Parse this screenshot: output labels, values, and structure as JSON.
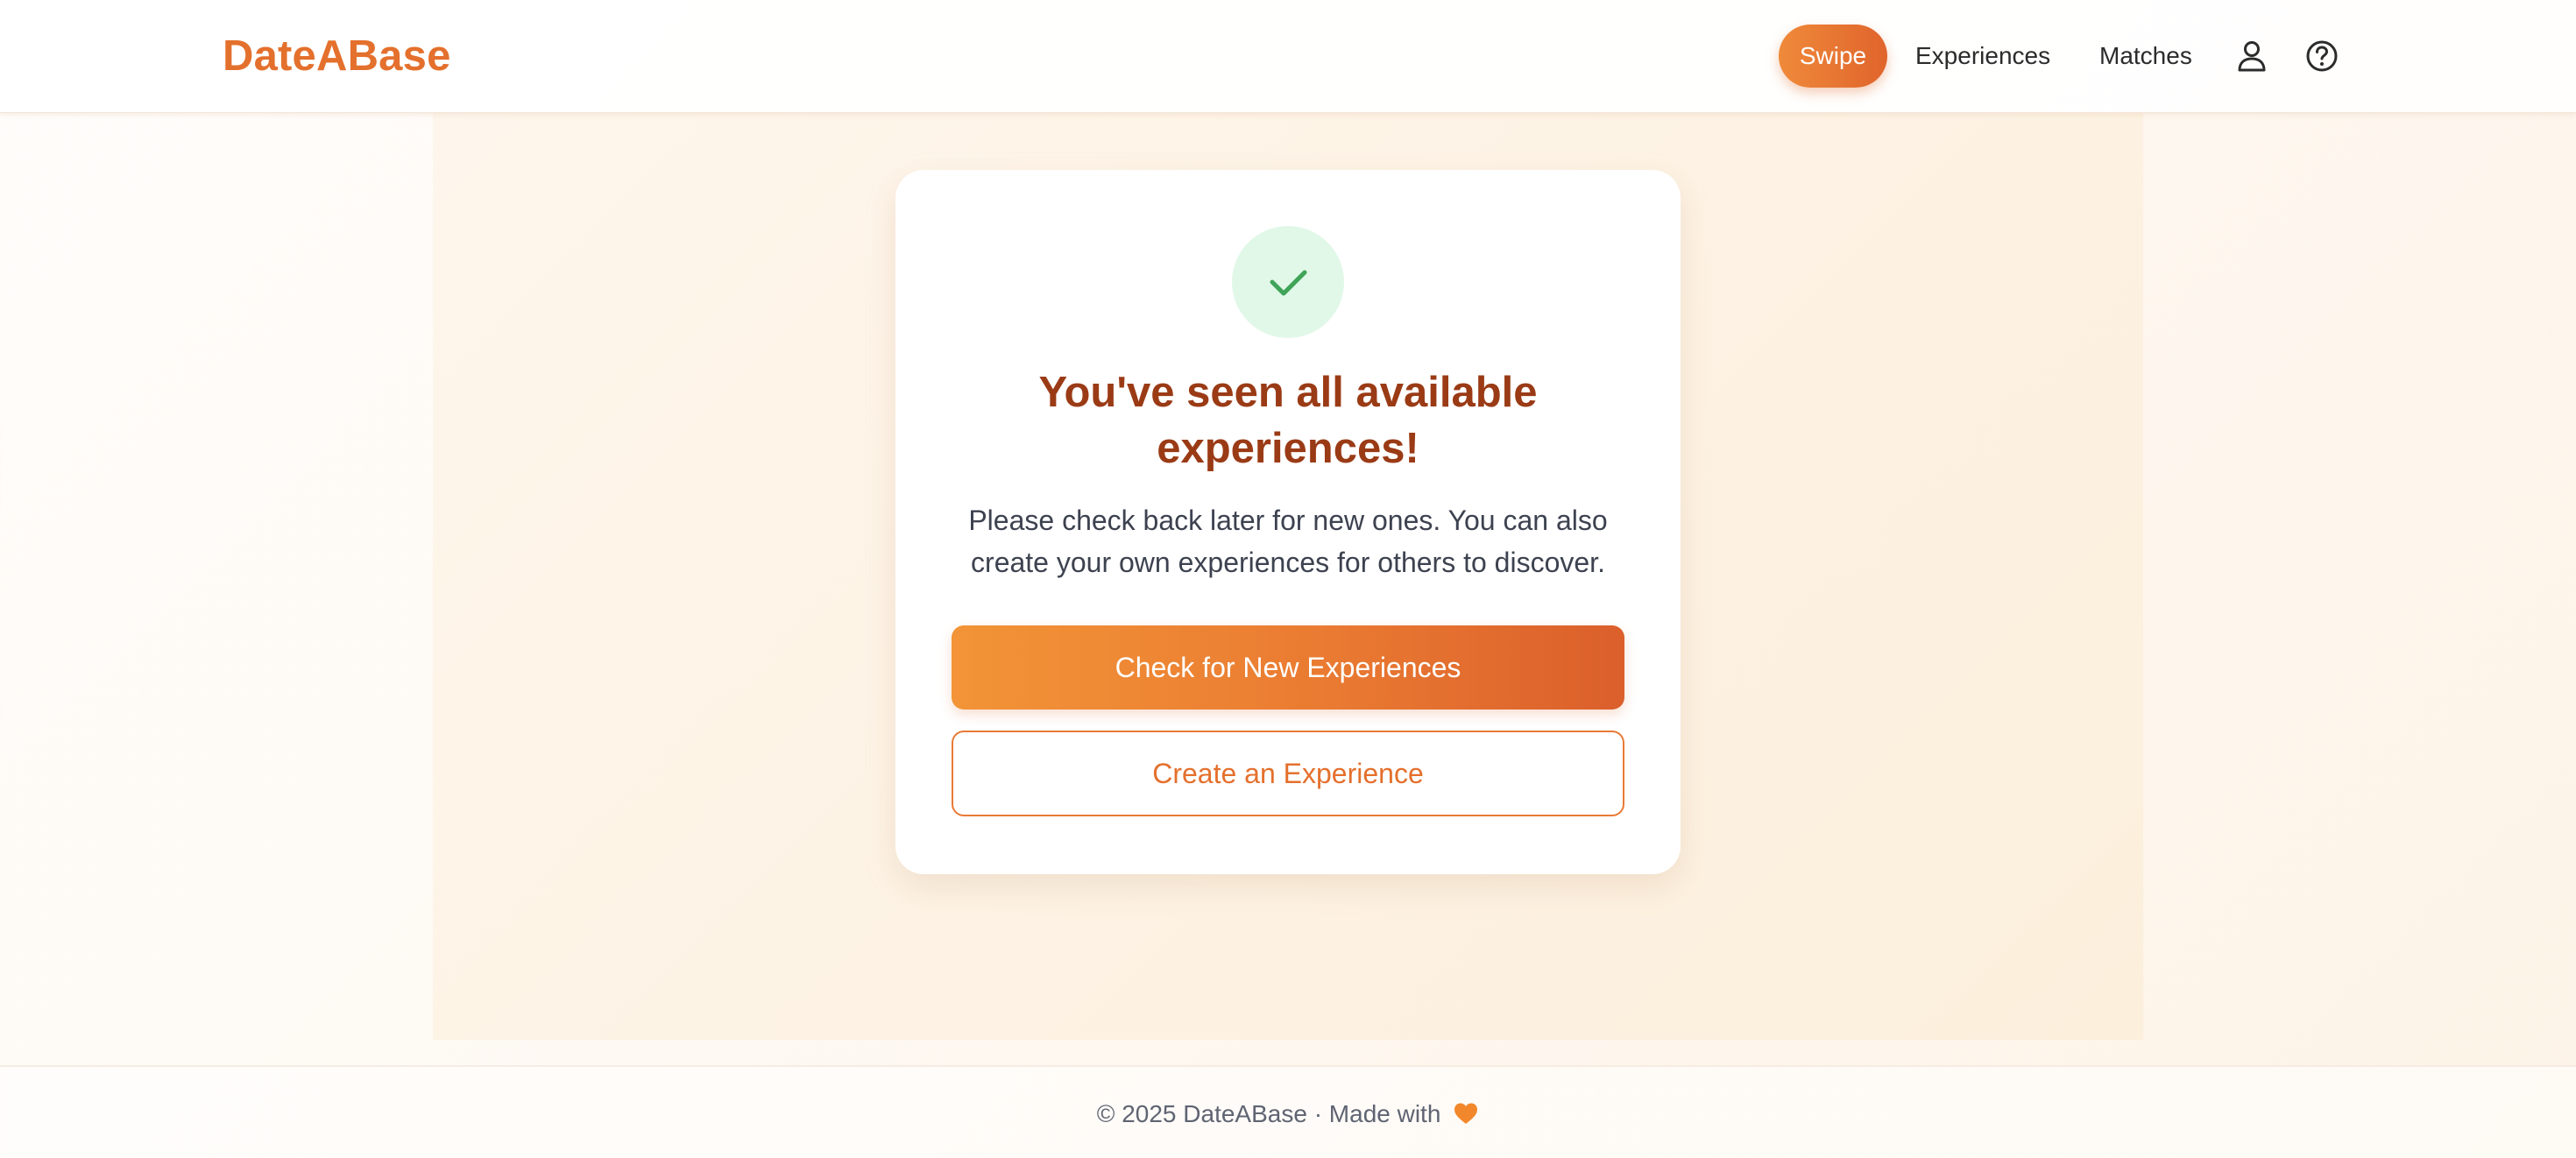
{
  "header": {
    "logo": "DateABase",
    "nav": {
      "swipe": "Swipe",
      "experiences": "Experiences",
      "matches": "Matches"
    },
    "icons": {
      "profile": "user-icon",
      "help": "help-circle-icon"
    }
  },
  "main": {
    "card": {
      "icon": "check-icon",
      "title": "You've seen all available experiences!",
      "message": "Please check back later for new ones. You can also create your own experiences for others to discover.",
      "primary_button": "Check for New Experiences",
      "secondary_button": "Create an Experience"
    }
  },
  "footer": {
    "text": "© 2025 DateABase · Made with",
    "icon": "heart-icon"
  },
  "colors": {
    "brand": "#e4702d",
    "title": "#9a3b16",
    "success_bg": "#e1f8e8",
    "success": "#3fa458"
  }
}
